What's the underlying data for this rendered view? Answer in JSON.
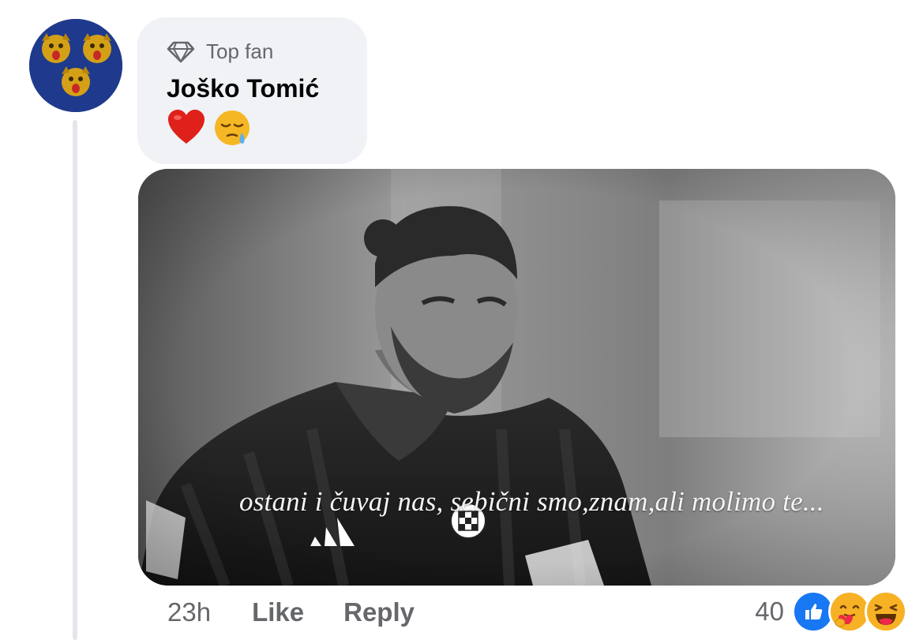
{
  "comment": {
    "badge_label": "Top fan",
    "author_name": "Joško Tomić",
    "body_emojis": [
      "heart-emoji",
      "sleepy-face-emoji"
    ],
    "media": {
      "caption": "ostani i čuvaj nas, sebični smo,znam,ali molimo te..."
    },
    "timestamp": "23h",
    "like_label": "Like",
    "reply_label": "Reply",
    "reaction_count": "40",
    "reaction_icons": [
      "like-reaction-icon",
      "care-reaction-icon",
      "haha-reaction-icon"
    ]
  },
  "colors": {
    "bubble_bg": "#f0f2f5",
    "meta_text": "#65676b",
    "like_blue": "#1877f2",
    "avatar_blue": "#1e3a8a"
  }
}
